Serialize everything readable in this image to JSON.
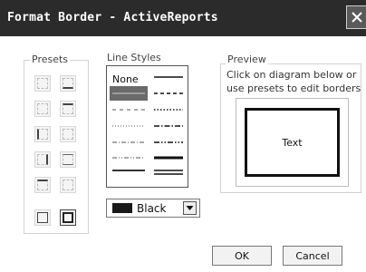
{
  "window": {
    "title": "Format Border - ActiveReports"
  },
  "groups": {
    "presets_label": "Presets",
    "line_styles_label": "Line Styles",
    "preview_label": "Preview"
  },
  "line_styles": {
    "none_label": "None",
    "selected": "thin-dotted-gray"
  },
  "color": {
    "value": "Black",
    "swatch": "#1a1a1a"
  },
  "preview": {
    "instructions_line1": "Click on diagram below or",
    "instructions_line2": "use presets to edit borders",
    "sample_text": "Text"
  },
  "buttons": {
    "ok": "OK",
    "cancel": "Cancel"
  },
  "icons": {
    "close": "close-icon",
    "dropdown": "chevron-down-icon"
  }
}
